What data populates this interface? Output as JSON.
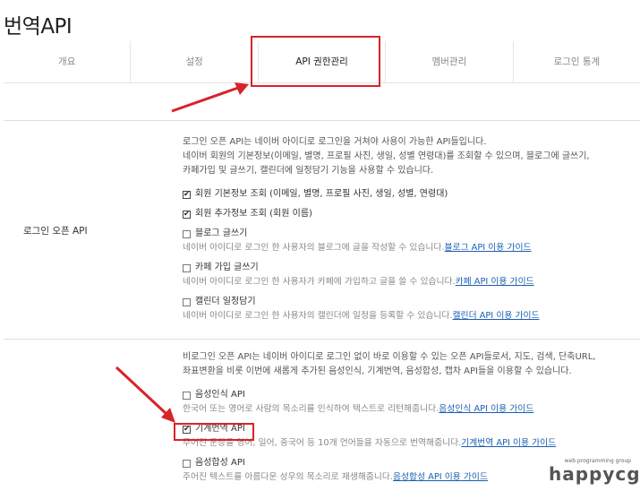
{
  "page": {
    "title": "번역API"
  },
  "tabs": [
    {
      "label": "개요",
      "active": false
    },
    {
      "label": "설정",
      "active": false
    },
    {
      "label": "API 권한관리",
      "active": true
    },
    {
      "label": "멤버관리",
      "active": false
    },
    {
      "label": "로그인 통계",
      "active": false
    }
  ],
  "login_api": {
    "label": "로그인 오픈 API",
    "desc": [
      "로그인 오픈 API는 네이버 아이디로 로그인을 거쳐야 사용이 가능한 API들입니다.",
      "네이버 회원의 기본정보(이메일, 별명, 프로필 사진, 생일, 성별 연령대)를 조회할 수 있으며, 블로그에 글쓰기,",
      "카페가입 및 글쓰기, 캘린더에 일정담기 기능을 사용할 수 있습니다."
    ],
    "options": [
      {
        "label": "회원 기본정보 조회 (이메일, 별명, 프로필 사진, 생일, 성별, 연령대)",
        "checked": true
      },
      {
        "label": "회원 추가정보 조회 (회원 이름)",
        "checked": true
      },
      {
        "label": "블로그 글쓰기",
        "checked": false,
        "sub": "네이버 아이디로 로그인 한 사용자의 블로그에 글을 작성할 수 있습니다.",
        "link": "블로그 API 이용 가이드"
      },
      {
        "label": "카페 가입 글쓰기",
        "checked": false,
        "sub": "네이버 아이디로 로그인 한 사용자가 카페에 가입하고 글을 쓸 수 있습니다.",
        "link": "카페 API 이용 가이드"
      },
      {
        "label": "캘린더 일정담기",
        "checked": false,
        "sub": "네이버 아이디로 로그인 한 사용자의 캘린더에 일정을 등록할 수 있습니다.",
        "link": "캘린더 API 이용 가이드"
      }
    ]
  },
  "nonlogin_api": {
    "desc": [
      "비로그인 오픈 API는 네이버 아이디로 로그인 없이 바로 이용할 수 있는 오픈 API들로서, 지도, 검색, 단축URL,",
      "좌표변환을 비롯 이번에 새롭게 추가된 음성인식, 기계번역, 음성합성, 캡차 API들을 이용할 수 있습니다."
    ],
    "options": [
      {
        "label": "음성인식 API",
        "checked": false,
        "sub": "한국어 또는 영어로 사람의 목소리를 인식하여 텍스트로 리턴해줍니다.",
        "link": "음성인식 API 이용 가이드"
      },
      {
        "label": "기계번역 API",
        "checked": true,
        "sub": "주어진 문장을 영어, 일어, 중국어 등 10개 언어들을 자동으로 번역해줍니다.",
        "link": "기계번역 API 이용 가이드"
      },
      {
        "label": "음성합성 API",
        "checked": false,
        "sub": "주어진 텍스트를 아름다운 성우의 목소리로 재생해줍니다.",
        "link": "음성합성 API 이용 가이드"
      }
    ]
  },
  "watermark": {
    "small": "web programming group",
    "brand": "happycgi"
  },
  "colors": {
    "highlight": "#d8232a",
    "link": "#1a5fb4"
  },
  "icons": [
    "checkbox-checked-icon",
    "checkbox-empty-icon",
    "red-arrow-icon"
  ]
}
